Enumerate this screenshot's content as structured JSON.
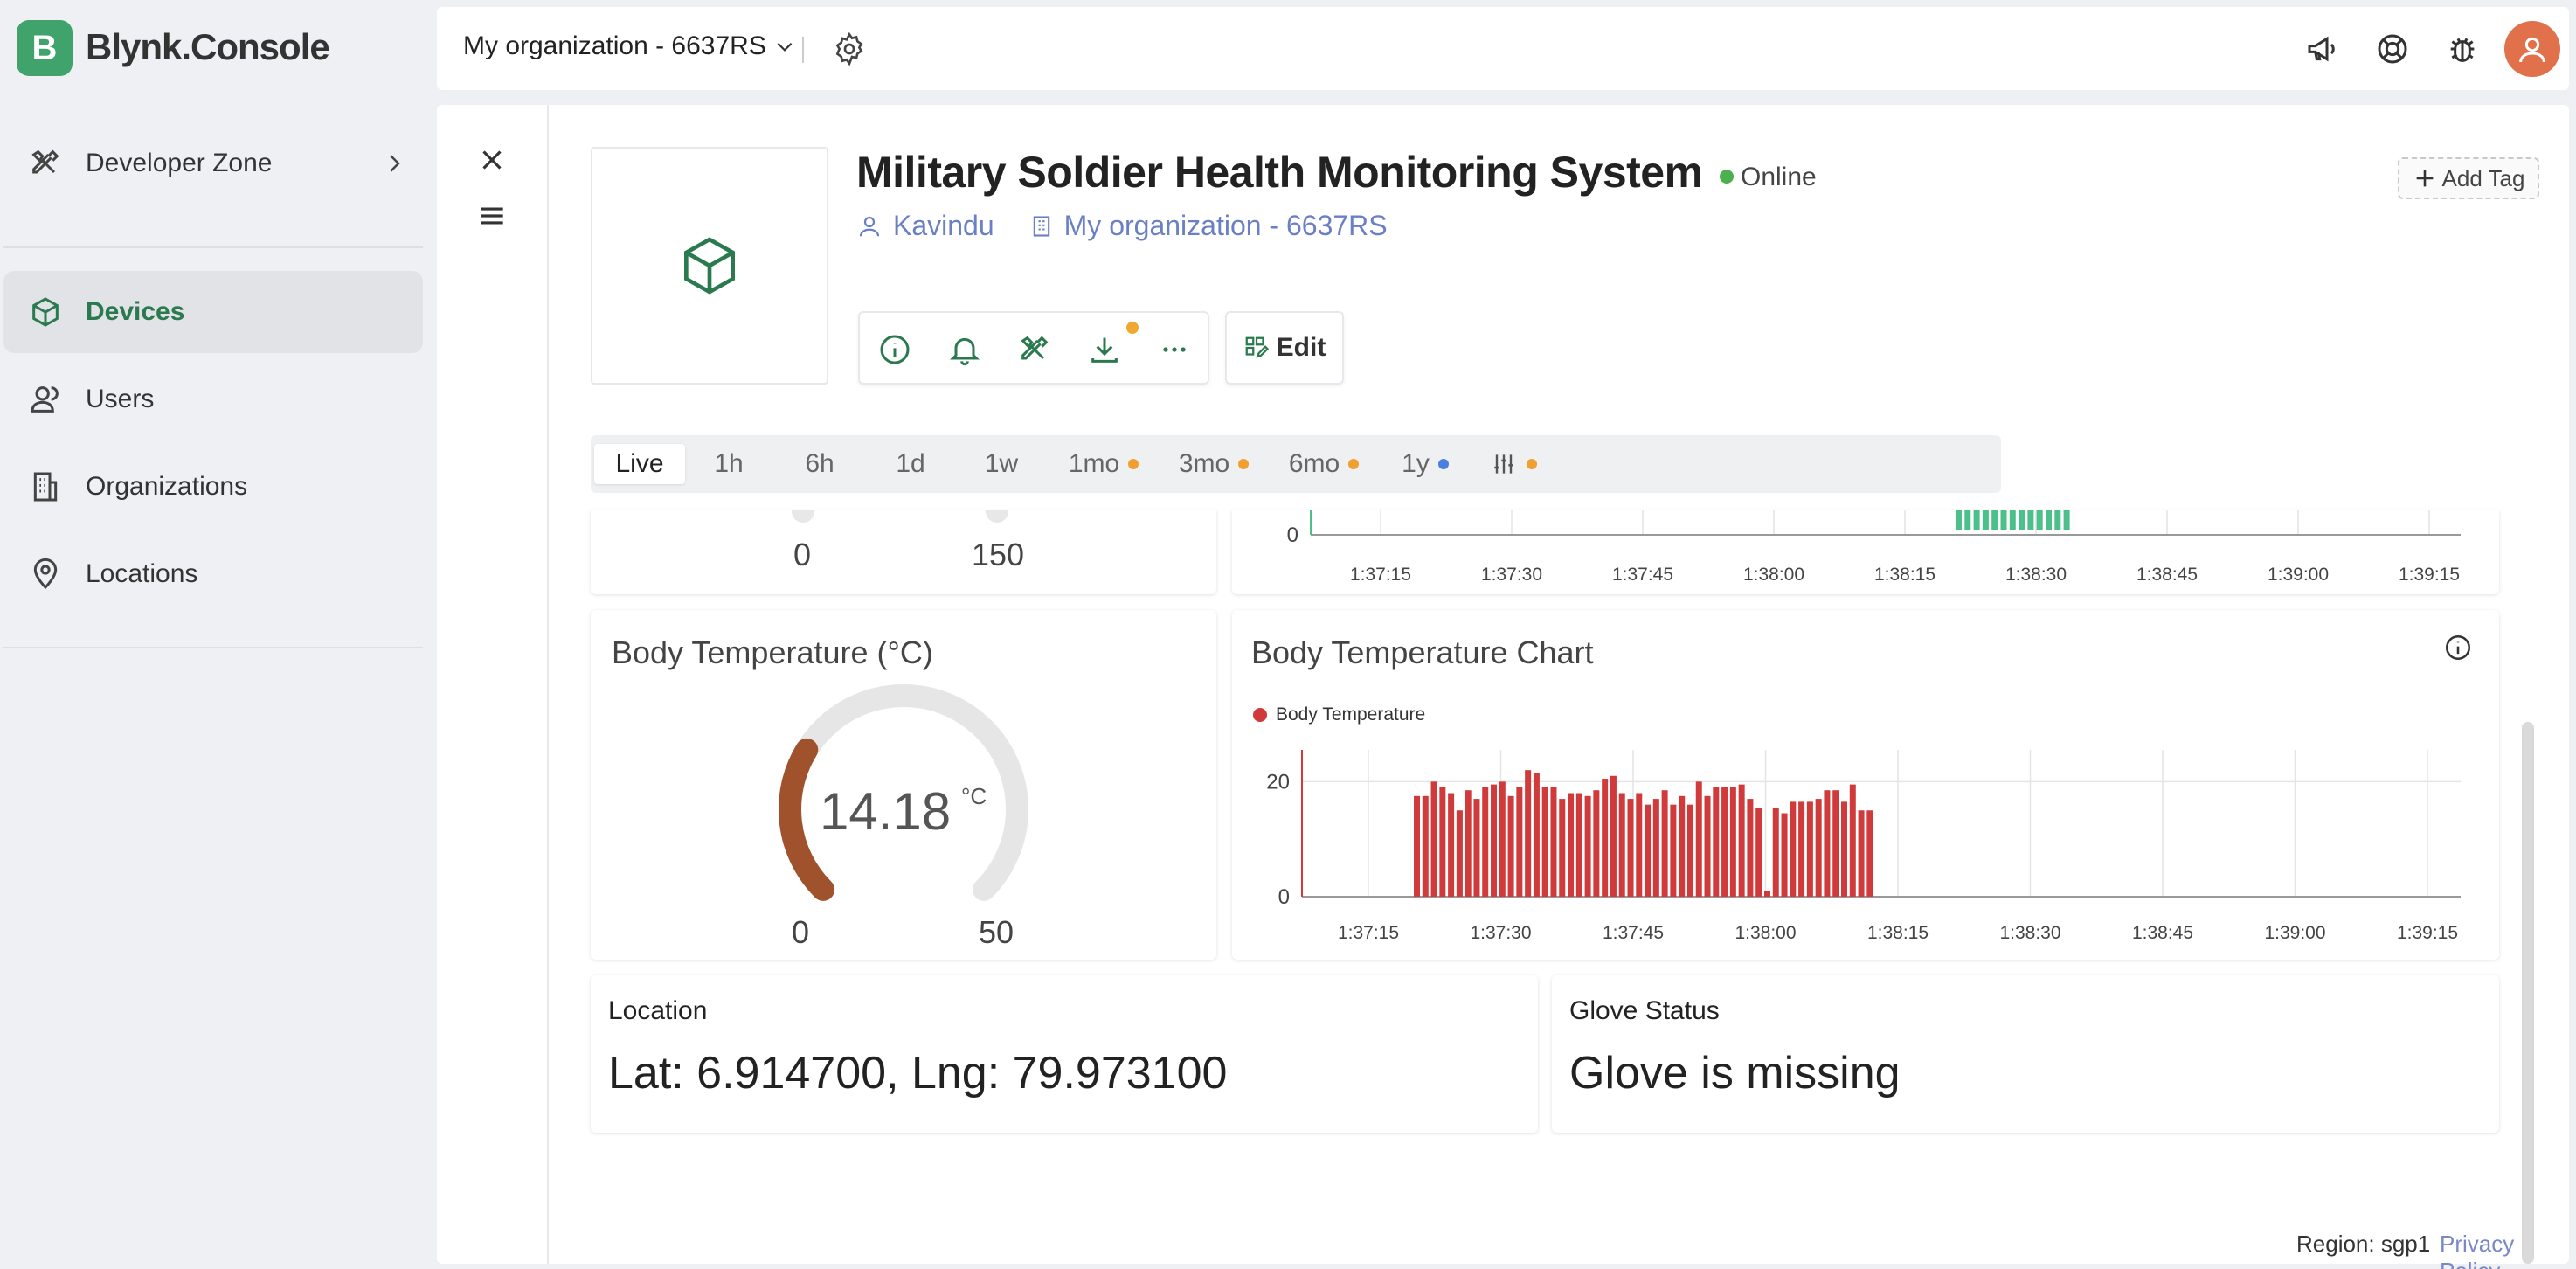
{
  "app": {
    "logo_letter": "B",
    "brand": "Blynk.Console"
  },
  "sidebar": {
    "items": [
      {
        "label": "Developer Zone",
        "icon": "tools-icon"
      },
      {
        "label": "Devices",
        "icon": "cube-icon",
        "active": true
      },
      {
        "label": "Users",
        "icon": "users-icon"
      },
      {
        "label": "Organizations",
        "icon": "building-icon"
      },
      {
        "label": "Locations",
        "icon": "map-pin-icon"
      }
    ]
  },
  "topbar": {
    "org_name": "My organization - 6637RS",
    "icons": [
      "megaphone-icon",
      "help-lifebuoy-icon",
      "bug-icon",
      "avatar"
    ]
  },
  "device": {
    "title": "Military Soldier Health Monitoring System",
    "status": "Online",
    "owner": "Kavindu",
    "organization": "My organization - 6637RS",
    "add_tag": "Add Tag",
    "edit": "Edit"
  },
  "time_ranges": [
    {
      "label": "Live",
      "active": true
    },
    {
      "label": "1h"
    },
    {
      "label": "6h"
    },
    {
      "label": "1d"
    },
    {
      "label": "1w"
    },
    {
      "label": "1mo",
      "dot": "#f0a030"
    },
    {
      "label": "3mo",
      "dot": "#f0a030"
    },
    {
      "label": "6mo",
      "dot": "#f0a030"
    },
    {
      "label": "1y",
      "dot": "#4a7fe0"
    },
    {
      "label": "",
      "icon": "sliders-icon",
      "dot": "#f0a030"
    }
  ],
  "top_gauge": {
    "min": "0",
    "max": "150"
  },
  "body_temp_gauge": {
    "title": "Body Temperature (°C)",
    "value": "14.18",
    "unit": "°C",
    "min": "0",
    "max": "50",
    "fraction": 0.2836,
    "color": "#a0522d"
  },
  "chart_data": [
    {
      "type": "bar",
      "title": "",
      "x_ticks": [
        "1:37:15",
        "1:37:30",
        "1:37:45",
        "1:38:00",
        "1:38:15",
        "1:38:30",
        "1:38:45",
        "1:39:00",
        "1:39:15"
      ],
      "y_ticks": [
        "0"
      ],
      "color": "#4cbf8a",
      "note_partial": true
    },
    {
      "type": "bar",
      "title": "Body Temperature Chart",
      "legend": "Body Temperature",
      "color": "#d03a3a",
      "x_ticks": [
        "1:37:15",
        "1:37:30",
        "1:37:45",
        "1:38:00",
        "1:38:15",
        "1:38:30",
        "1:38:45",
        "1:39:00",
        "1:39:15"
      ],
      "y_ticks": [
        "20",
        "0"
      ],
      "ylim": [
        0,
        24
      ],
      "values": [
        17.5,
        17.5,
        20,
        19,
        18,
        15,
        18.5,
        17,
        19,
        19.5,
        20,
        17.5,
        19,
        22,
        21.5,
        19,
        19,
        17,
        18,
        18,
        17.5,
        18.5,
        20.5,
        21,
        18,
        17,
        18,
        16,
        17,
        18.5,
        16,
        17.5,
        16,
        20,
        17.5,
        19,
        19,
        19,
        19.5,
        17,
        15.5,
        1,
        15.5,
        14.5,
        16.5,
        16.5,
        16.5,
        17,
        18.5,
        18.5,
        16.5,
        19.5,
        15,
        15
      ]
    }
  ],
  "location": {
    "title": "Location",
    "value": "Lat: 6.914700, Lng: 79.973100"
  },
  "glove": {
    "title": "Glove Status",
    "value": "Glove is missing"
  },
  "footer": {
    "region": "Region: sgp1",
    "privacy": "Privacy Policy"
  }
}
